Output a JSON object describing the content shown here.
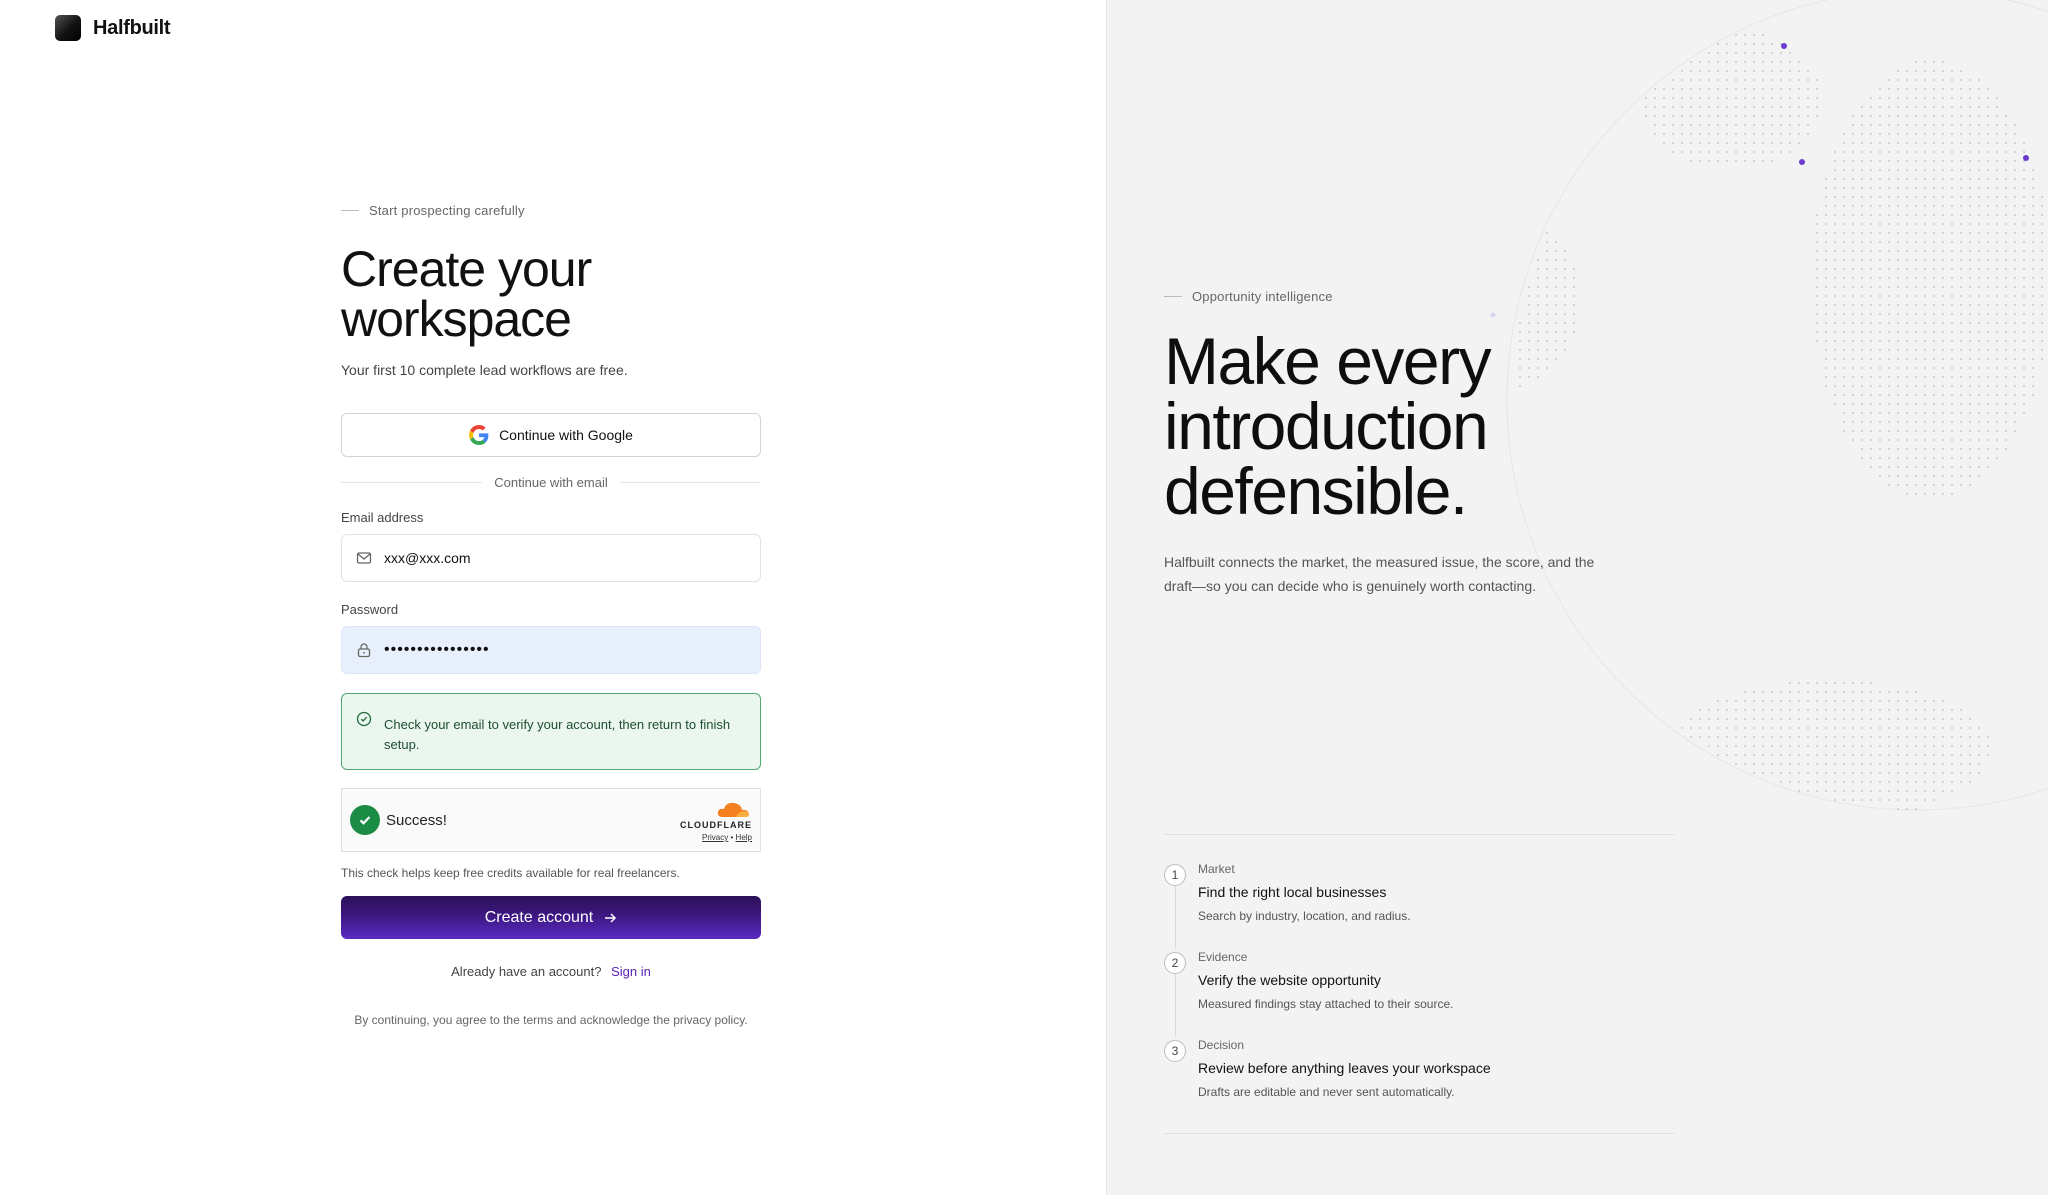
{
  "brand": {
    "name": "Halfbuilt"
  },
  "signup": {
    "eyebrow": "Start prospecting carefully",
    "title": "Create your workspace",
    "subtitle": "Your first 10 complete lead workflows are free.",
    "google_label": "Continue with Google",
    "divider_label": "Continue with email",
    "email_label": "Email address",
    "email_value": "xxx@xxx.com",
    "password_label": "Password",
    "password_value": "••••••••••••••••",
    "alert_text": "Check your email to verify your account, then return to finish setup.",
    "turnstile": {
      "status": "Success!",
      "provider": "CLOUDFLARE",
      "privacy": "Privacy",
      "separator": "•",
      "help": "Help"
    },
    "helper_text": "This check helps keep free credits available for real freelancers.",
    "submit_label": "Create account",
    "signin_prompt": "Already have an account?",
    "signin_link": "Sign in",
    "legal": "By continuing, you agree to the terms and acknowledge the privacy policy."
  },
  "promo": {
    "eyebrow": "Opportunity intelligence",
    "title": "Make every introduction defensible.",
    "description": "Halfbuilt connects the market, the measured issue, the score, and the draft—so you can decide who is genuinely worth contacting.",
    "steps": [
      {
        "number": "1",
        "kicker": "Market",
        "title": "Find the right local businesses",
        "description": "Search by industry, location, and radius."
      },
      {
        "number": "2",
        "kicker": "Evidence",
        "title": "Verify the website opportunity",
        "description": "Measured findings stay attached to their source."
      },
      {
        "number": "3",
        "kicker": "Decision",
        "title": "Review before anything leaves your workspace",
        "description": "Drafts are editable and never sent automatically."
      }
    ]
  },
  "colors": {
    "accent": "#5b21b6",
    "button_gradient_top": "#2c1059",
    "button_gradient_bottom": "#5a2cc4",
    "success_border": "#4fa772",
    "success_bg": "#eaf6ee",
    "right_panel_bg": "#f3f3f3"
  },
  "icons": [
    "google-icon",
    "mail-icon",
    "lock-icon",
    "check-circle-icon",
    "checkmark-icon",
    "cloudflare-cloud-icon",
    "arrow-right-icon"
  ]
}
